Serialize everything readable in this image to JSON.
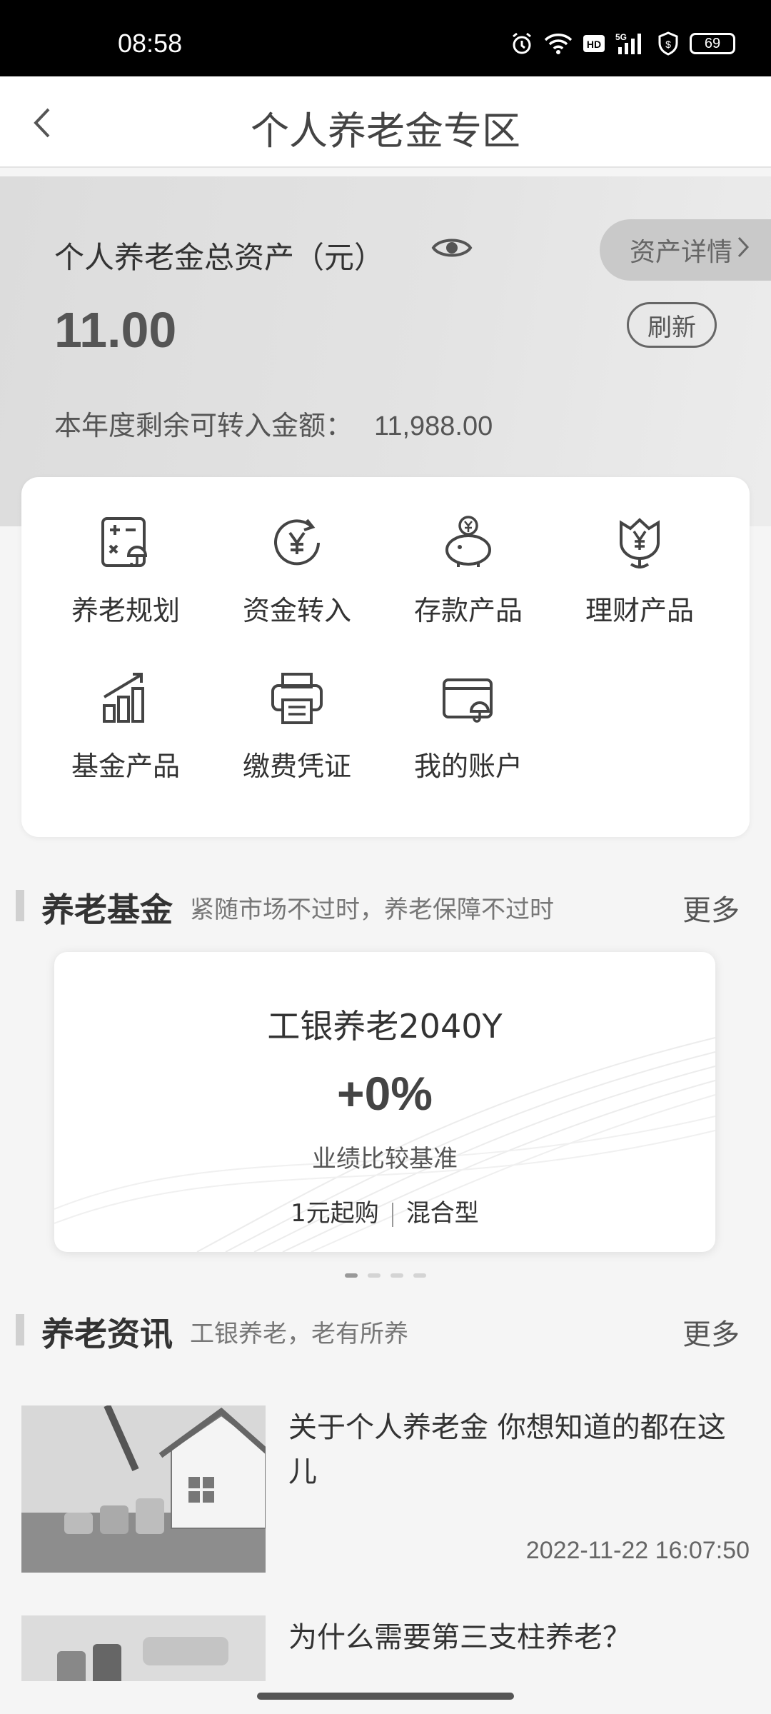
{
  "status_bar": {
    "time": "08:58",
    "battery": "69",
    "icons": [
      "alarm-icon",
      "wifi-icon",
      "hd-icon",
      "5g-signal-icon",
      "shield-icon"
    ]
  },
  "header": {
    "title": "个人养老金专区",
    "back_icon": "chevron-left-icon"
  },
  "asset": {
    "label": "个人养老金总资产（元）",
    "details_label": "资产详情",
    "amount": "11.00",
    "refresh_label": "刷新",
    "remain_label": "本年度剩余可转入金额：",
    "remain_value": "11,988.00"
  },
  "menu": {
    "items": [
      {
        "label": "养老规划",
        "icon": "calculator-umbrella-icon"
      },
      {
        "label": "资金转入",
        "icon": "yuan-transfer-icon"
      },
      {
        "label": "存款产品",
        "icon": "piggy-bank-icon"
      },
      {
        "label": "理财产品",
        "icon": "yuan-flower-icon"
      },
      {
        "label": "基金产品",
        "icon": "bar-chart-trend-icon"
      },
      {
        "label": "缴费凭证",
        "icon": "printer-icon"
      },
      {
        "label": "我的账户",
        "icon": "card-umbrella-icon"
      }
    ]
  },
  "fund_section": {
    "title": "养老基金",
    "subtitle": "紧随市场不过时，养老保障不过时",
    "more": "更多"
  },
  "fund_card": {
    "name": "工银养老2040Y",
    "rate": "+0%",
    "benchmark": "业绩比较基准",
    "min_purchase": "1元起购",
    "type": "混合型"
  },
  "carousel": {
    "count": 4,
    "active": 0
  },
  "news_section": {
    "title": "养老资讯",
    "subtitle": "工银养老，老有所养",
    "more": "更多"
  },
  "news": [
    {
      "title": "关于个人养老金  你想知道的都在这儿",
      "date": "2022-11-22  16:07:50"
    },
    {
      "title": "为什么需要第三支柱养老？"
    }
  ]
}
